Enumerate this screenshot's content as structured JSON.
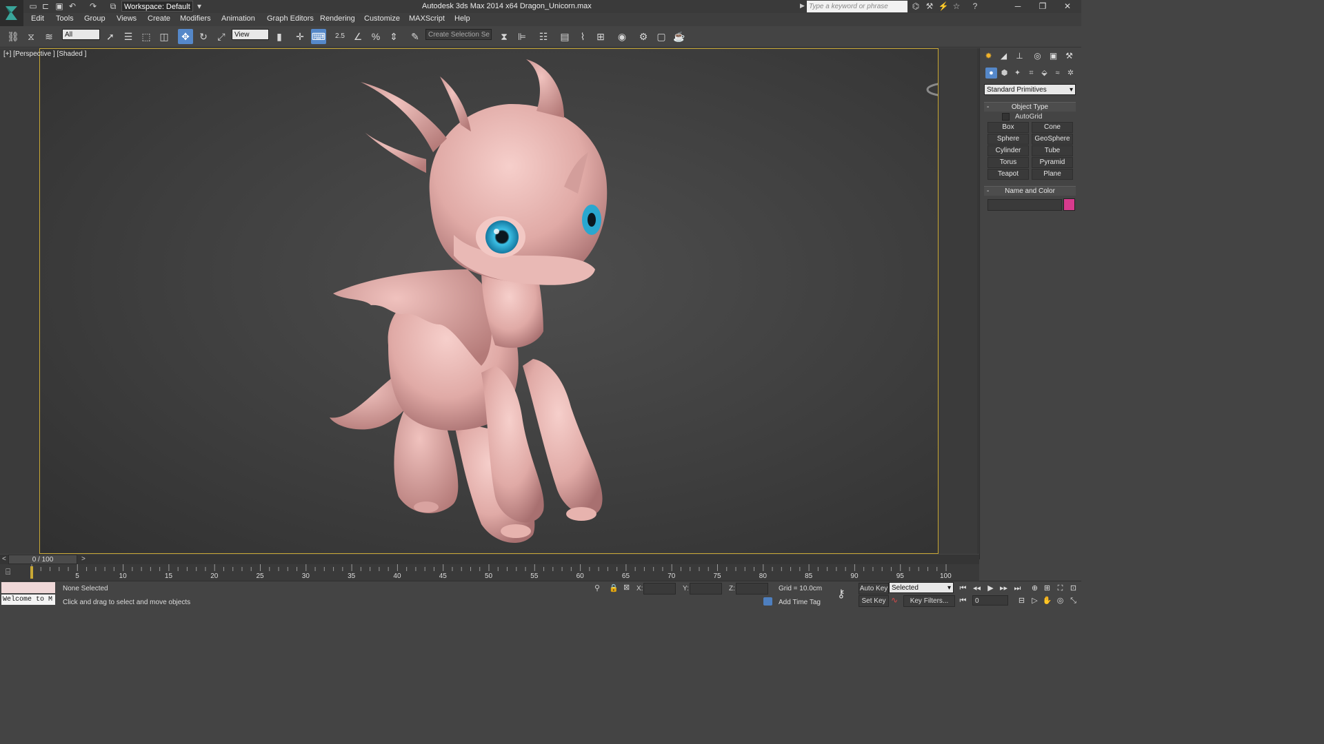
{
  "titlebar": {
    "workspace": "Workspace: Default",
    "title": "Autodesk 3ds Max  2014 x64     Dragon_Unicorn.max",
    "search_placeholder": "Type a keyword or phrase"
  },
  "menu": [
    "Edit",
    "Tools",
    "Group",
    "Views",
    "Create",
    "Modifiers",
    "Animation",
    "Graph Editors",
    "Rendering",
    "Customize",
    "MAXScript",
    "Help"
  ],
  "toolbar": {
    "selection_filter": "All",
    "ref_coord": "View",
    "snap_value": "2.5",
    "named_selection": "Create Selection Se"
  },
  "viewport": {
    "label": "[+] [Perspective ] [Shaded ]"
  },
  "command_panel": {
    "category": "Standard Primitives",
    "object_type_header": "Object Type",
    "autogrid": "AutoGrid",
    "primitives": [
      "Box",
      "Cone",
      "Sphere",
      "GeoSphere",
      "Cylinder",
      "Tube",
      "Torus",
      "Pyramid",
      "Teapot",
      "Plane"
    ],
    "name_color_header": "Name and Color",
    "object_color": "#d83b8e"
  },
  "timeline": {
    "slider_label": "0 / 100",
    "ticks": [
      "5",
      "10",
      "15",
      "20",
      "25",
      "30",
      "35",
      "40",
      "45",
      "50",
      "55",
      "60",
      "65",
      "70",
      "75",
      "80",
      "85",
      "90",
      "95",
      "100"
    ]
  },
  "status": {
    "selection": "None Selected",
    "prompt": "Click and drag to select and move objects",
    "maxscript_output": "Welcome to M",
    "x_label": "X:",
    "y_label": "Y:",
    "z_label": "Z:",
    "grid": "Grid = 10.0cm",
    "add_time_tag": "Add Time Tag",
    "auto_key": "Auto Key",
    "set_key": "Set Key",
    "key_mode": "Selected",
    "key_filters": "Key Filters...",
    "current_frame": "0"
  },
  "colors": {
    "viewport_border": "#c9a834",
    "active_tool": "#5588c9",
    "dragon_skin": "#e9b9b5",
    "dragon_eye": "#2aa7cf"
  }
}
